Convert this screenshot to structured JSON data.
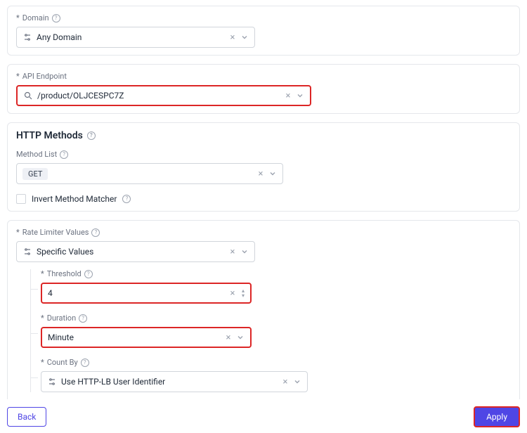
{
  "domainSection": {
    "label": "Domain",
    "value": "Any Domain"
  },
  "endpointSection": {
    "label": "API Endpoint",
    "value": "/product/OLJCESPC7Z"
  },
  "httpMethods": {
    "heading": "HTTP Methods",
    "listLabel": "Method List",
    "tag": "GET",
    "invertLabel": "Invert Method Matcher"
  },
  "rateLimiter": {
    "label": "Rate Limiter Values",
    "value": "Specific Values",
    "threshold": {
      "label": "Threshold",
      "value": "4"
    },
    "duration": {
      "label": "Duration",
      "value": "Minute"
    },
    "countBy": {
      "label": "Count By",
      "value": "Use HTTP-LB User Identifier"
    }
  },
  "footer": {
    "back": "Back",
    "apply": "Apply"
  }
}
